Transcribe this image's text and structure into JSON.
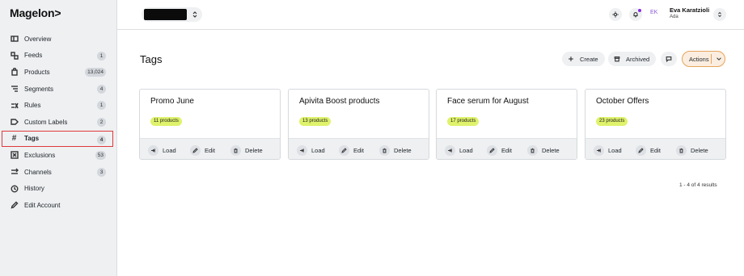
{
  "sidebar": {
    "logo": "Magelon>",
    "items": [
      {
        "label": "Overview",
        "icon": "overview-icon",
        "badge": ""
      },
      {
        "label": "Feeds",
        "icon": "feeds-icon",
        "badge": "1"
      },
      {
        "label": "Products",
        "icon": "products-icon",
        "badge": "13,024"
      },
      {
        "label": "Segments",
        "icon": "segments-icon",
        "badge": "4"
      },
      {
        "label": "Rules",
        "icon": "rules-icon",
        "badge": "1"
      },
      {
        "label": "Custom Labels",
        "icon": "label-icon",
        "badge": "2"
      },
      {
        "label": "Tags",
        "icon": "hash-icon",
        "badge": "4"
      },
      {
        "label": "Exclusions",
        "icon": "exclusions-icon",
        "badge": "53"
      },
      {
        "label": "Channels",
        "icon": "channels-icon",
        "badge": "3"
      },
      {
        "label": "History",
        "icon": "history-icon",
        "badge": ""
      },
      {
        "label": "Edit Account",
        "icon": "pencil-icon",
        "badge": ""
      }
    ]
  },
  "topbar": {
    "user_initials": "EK",
    "user_name": "Eva Karatzioli",
    "user_org": "Ada"
  },
  "main": {
    "title": "Tags",
    "create_label": "Create",
    "archived_label": "Archived",
    "actions_label": "Actions",
    "results_text": "1 - 4 of 4 results",
    "cards": [
      {
        "title": "Promo June",
        "badge": "11 products"
      },
      {
        "title": "Apivita Boost products",
        "badge": "13 products"
      },
      {
        "title": "Face serum for August",
        "badge": "17 products"
      },
      {
        "title": "October Offers",
        "badge": "23 products"
      }
    ],
    "card_actions": {
      "load": "Load",
      "edit": "Edit",
      "delete": "Delete"
    }
  },
  "colors": {
    "accent_active_border": "#e03a3a",
    "product_badge": "#dff26b",
    "actions_border": "#e6a55c",
    "notification_dot": "#8a2be2"
  }
}
